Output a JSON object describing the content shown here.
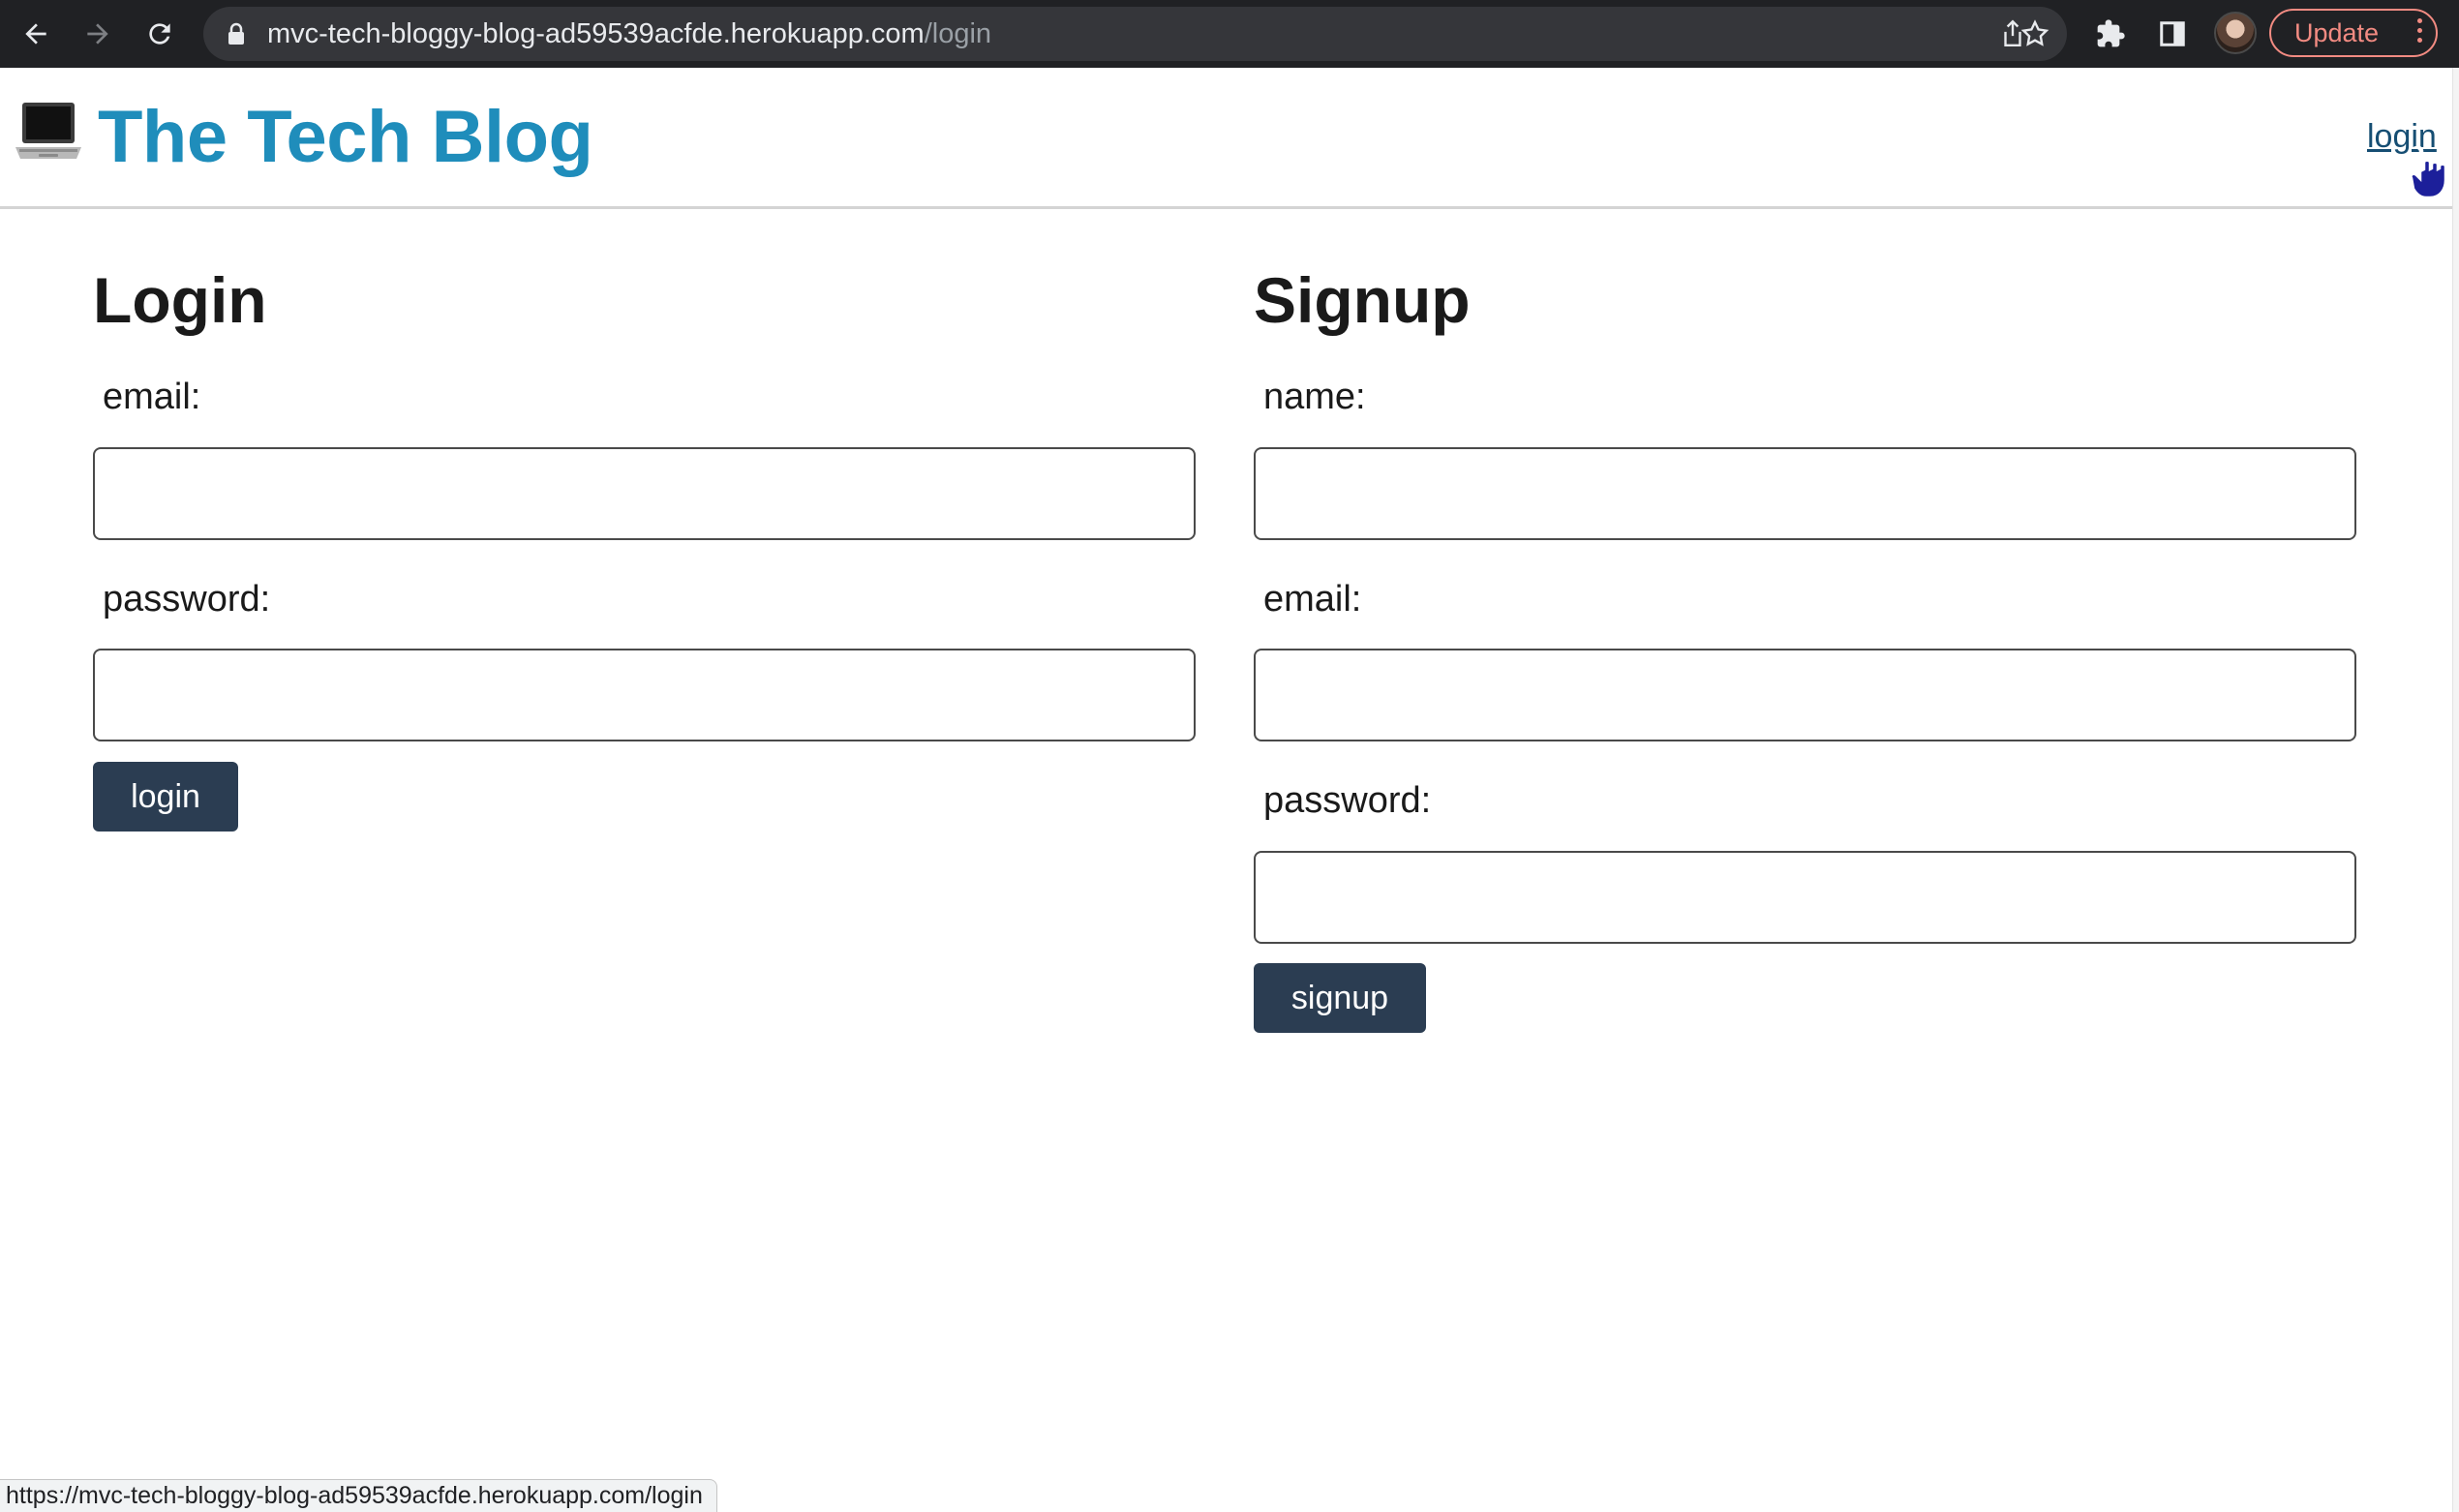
{
  "browser": {
    "url_host": "mvc-tech-bloggy-blog-ad59539acfde.herokuapp.com",
    "url_path": "/login",
    "update_label": "Update",
    "status_url": "https://mvc-tech-bloggy-blog-ad59539acfde.herokuapp.com/login"
  },
  "header": {
    "title": "The Tech Blog",
    "logo_icon": "laptop-icon",
    "nav_login": "login"
  },
  "login_form": {
    "heading": "Login",
    "email_label": "email:",
    "email_value": "",
    "password_label": "password:",
    "password_value": "",
    "submit_label": "login"
  },
  "signup_form": {
    "heading": "Signup",
    "name_label": "name:",
    "name_value": "",
    "email_label": "email:",
    "email_value": "",
    "password_label": "password:",
    "password_value": "",
    "submit_label": "signup"
  },
  "colors": {
    "title": "#1f8dbb",
    "button": "#2b3d52",
    "chrome": "#202124",
    "update_accent": "#f28b82"
  }
}
